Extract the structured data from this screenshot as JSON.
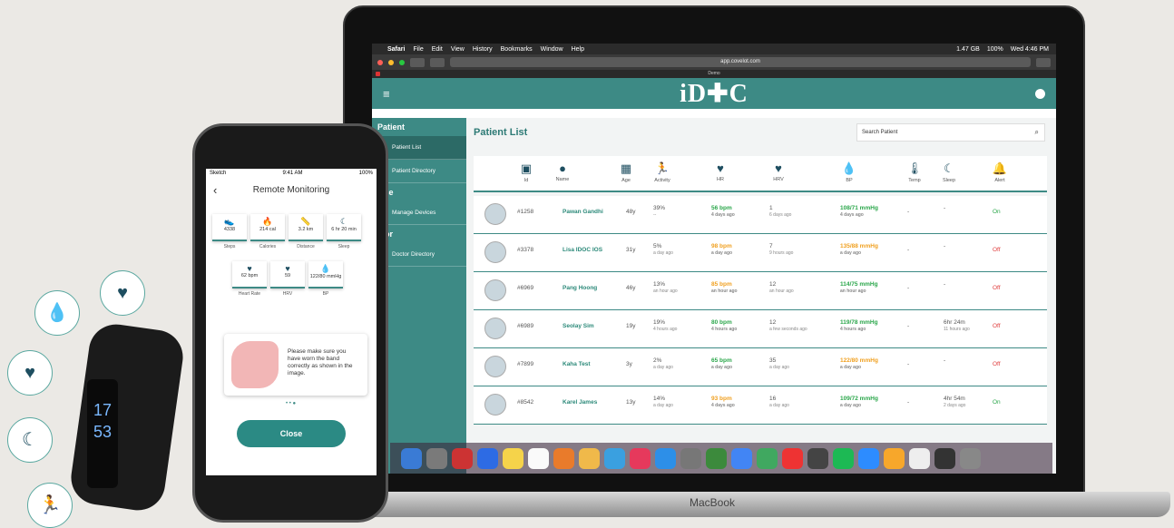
{
  "menubar": {
    "apple": "",
    "app": "Safari",
    "items": [
      "File",
      "Edit",
      "View",
      "History",
      "Bookmarks",
      "Window",
      "Help"
    ],
    "status": [
      "1.47 GB",
      "100%",
      "Wed 4:46 PM"
    ]
  },
  "browser": {
    "url": "app.covelot.com",
    "tab_title": "Demo"
  },
  "app": {
    "logo": "iD✚C",
    "title": "Patient List",
    "search_placeholder": "Search Patient"
  },
  "sidebar": {
    "sections": [
      {
        "header": "Patient",
        "items": [
          "Patient List",
          "Patient Directory"
        ]
      },
      {
        "header": "vice",
        "items": [
          "Manage Devices"
        ]
      },
      {
        "header": "ctor",
        "items": [
          "Doctor Directory"
        ]
      }
    ]
  },
  "columns": [
    "Id",
    "Name",
    "Age",
    "Activity",
    "HR",
    "HRV",
    "BP",
    "Temp",
    "Sleep",
    "Alert"
  ],
  "rows": [
    {
      "id": "#1258",
      "name": "Pawan Gandhi",
      "age": "48y",
      "activity": "39%",
      "activity_sub": "--",
      "hr": "56 bpm",
      "hr_sub": "4 days ago",
      "hrv": "1",
      "hrv_sub": "6 days ago",
      "bp": "108/71 mmHg",
      "bp_sub": "4 days ago",
      "temp": "-",
      "sleep": "-",
      "alert": "On"
    },
    {
      "id": "#3378",
      "name": "Lisa IDOC IOS",
      "age": "31y",
      "activity": "5%",
      "activity_sub": "a day ago",
      "hr": "98 bpm",
      "hr_sub": "a day ago",
      "hrv": "7",
      "hrv_sub": "9 hours ago",
      "bp": "135/88 mmHg",
      "bp_sub": "a day ago",
      "temp": "-",
      "sleep": "-",
      "alert": "Off"
    },
    {
      "id": "#6969",
      "name": "Pang Hoong",
      "age": "46y",
      "activity": "13%",
      "activity_sub": "an hour ago",
      "hr": "85 bpm",
      "hr_sub": "an hour ago",
      "hrv": "12",
      "hrv_sub": "an hour ago",
      "bp": "114/75 mmHg",
      "bp_sub": "an hour ago",
      "temp": "-",
      "sleep": "-",
      "alert": "Off"
    },
    {
      "id": "#6989",
      "name": "Seolay Sim",
      "age": "19y",
      "activity": "19%",
      "activity_sub": "4 hours ago",
      "hr": "80 bpm",
      "hr_sub": "4 hours ago",
      "hrv": "12",
      "hrv_sub": "a few seconds ago",
      "bp": "119/78 mmHg",
      "bp_sub": "4 hours ago",
      "temp": "-",
      "sleep": "6hr 24m",
      "sleep_sub": "11 hours ago",
      "alert": "Off"
    },
    {
      "id": "#7899",
      "name": "Kaha Test",
      "age": "3y",
      "activity": "2%",
      "activity_sub": "a day ago",
      "hr": "65 bpm",
      "hr_sub": "a day ago",
      "hrv": "35",
      "hrv_sub": "a day ago",
      "bp": "122/80 mmHg",
      "bp_sub": "a day ago",
      "temp": "-",
      "sleep": "-",
      "alert": "Off"
    },
    {
      "id": "#8542",
      "name": "Karel James",
      "age": "13y",
      "activity": "14%",
      "activity_sub": "a day ago",
      "hr": "93 bpm",
      "hr_sub": "4 days ago",
      "hrv": "16",
      "hrv_sub": "a day ago",
      "bp": "109/72 mmHg",
      "bp_sub": "a day ago",
      "temp": "-",
      "sleep": "4hr 54m",
      "sleep_sub": "2 days ago",
      "alert": "On"
    }
  ],
  "laptop_label": "MacBook",
  "phone": {
    "carrier": "Sketch",
    "time": "9:41 AM",
    "battery": "100%",
    "title": "Remote Monitoring",
    "cards": [
      {
        "value": "4338",
        "label": "Steps"
      },
      {
        "value": "214 cal",
        "label": "Calories"
      },
      {
        "value": "3.2 km",
        "label": "Distance"
      },
      {
        "value": "6 hr 20 min",
        "label": "Sleep"
      },
      {
        "value": "62 bpm",
        "label": "Heart Rate"
      },
      {
        "value": "59",
        "label": "HRV"
      },
      {
        "value": "122/80 mmHg",
        "label": "BP"
      }
    ],
    "message": "Please make sure you have worn the band correctly as shown in the image.",
    "close": "Close"
  },
  "band": {
    "time_h": "17",
    "time_m": "53"
  }
}
